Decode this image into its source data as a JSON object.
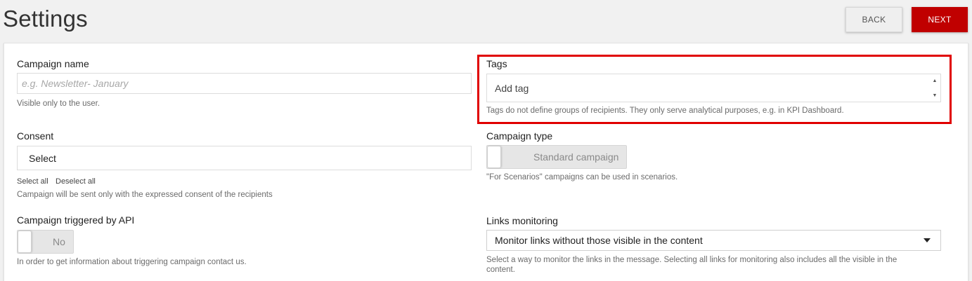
{
  "header": {
    "title": "Settings",
    "back_label": "BACK",
    "next_label": "NEXT"
  },
  "campaign_name": {
    "label": "Campaign name",
    "placeholder": "e.g. Newsletter- January",
    "help": "Visible only to the user."
  },
  "tags": {
    "label": "Tags",
    "input_text": "Add tag",
    "help": "Tags do not define groups of recipients. They only serve analytical purposes, e.g. in KPI Dashboard."
  },
  "consent": {
    "label": "Consent",
    "select_text": "Select",
    "select_all": "Select all",
    "deselect_all": "Deselect all",
    "help": "Campaign will be sent only with the expressed consent of the recipients"
  },
  "campaign_type": {
    "label": "Campaign type",
    "toggle_text": "Standard campaign",
    "help": "\"For Scenarios\" campaigns can be used in scenarios."
  },
  "api_trigger": {
    "label": "Campaign triggered by API",
    "toggle_text": "No",
    "help": "In order to get information about triggering campaign contact us."
  },
  "links_monitoring": {
    "label": "Links monitoring",
    "selected": "Monitor links without those visible in the content",
    "help": "Select a way to monitor the links in the message. Selecting all links for monitoring also includes all the visible in the content."
  },
  "colors": {
    "accent": "#c00000",
    "highlight": "#e00000"
  }
}
